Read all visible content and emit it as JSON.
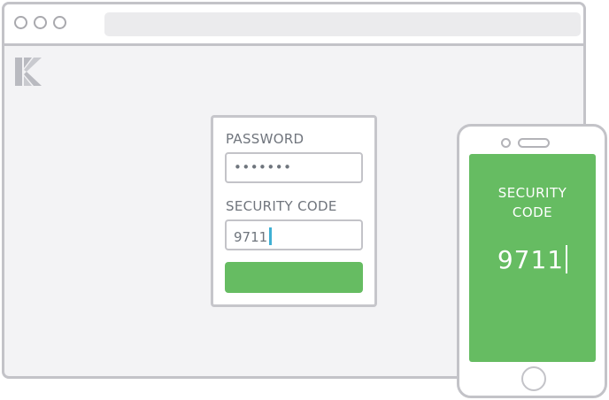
{
  "login_form": {
    "password_label": "PASSWORD",
    "password_mask": "•••••••",
    "security_code_label": "SECURITY CODE",
    "security_code_value": "9711"
  },
  "phone": {
    "screen_label": "SECURITY CODE",
    "code": "9711"
  },
  "colors": {
    "accent_green": "#66bc62",
    "caret_blue": "#3fb0d4",
    "frame_gray": "#c3c3c8"
  },
  "icons": [
    "window-close-dot",
    "window-minimize-dot",
    "window-maximize-dot",
    "brand-logo-icon",
    "phone-home-button"
  ]
}
